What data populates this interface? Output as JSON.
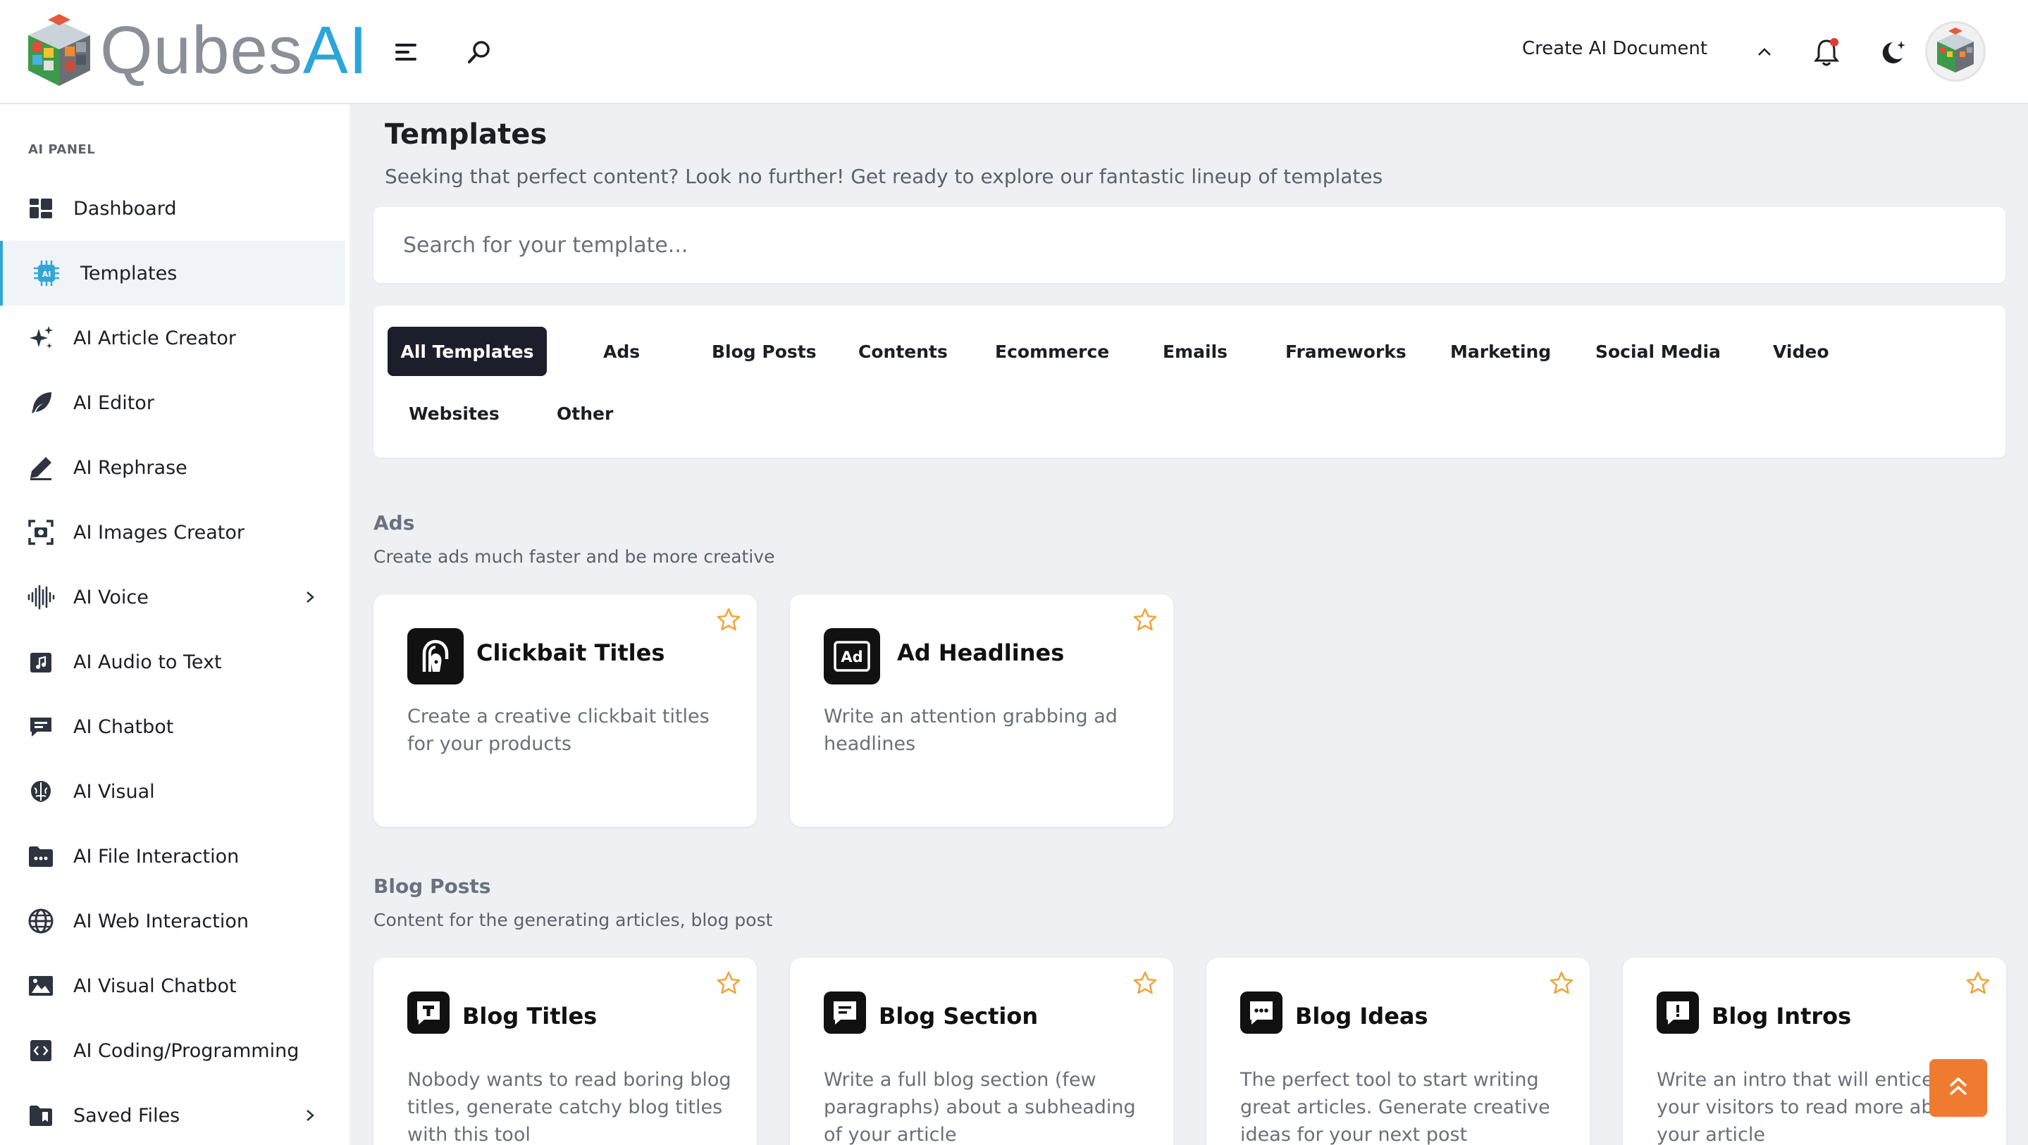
{
  "header": {
    "logo_main": "Qubes",
    "logo_accent": "AI",
    "create_doc_label": "Create AI Document",
    "notification_dot_color": "#e53935"
  },
  "sidebar": {
    "panel_title": "AI PANEL",
    "items": [
      {
        "label": "Dashboard",
        "icon": "dashboard-icon"
      },
      {
        "label": "Templates",
        "icon": "ai-chip-icon",
        "active": true
      },
      {
        "label": "AI Article Creator",
        "icon": "sparkles-icon"
      },
      {
        "label": "AI Editor",
        "icon": "feather-icon"
      },
      {
        "label": "AI Rephrase",
        "icon": "pen-icon"
      },
      {
        "label": "AI Images Creator",
        "icon": "image-scan-icon"
      },
      {
        "label": "AI Voice",
        "icon": "soundwave-icon",
        "has_children": true
      },
      {
        "label": "AI Audio to Text",
        "icon": "music-file-icon"
      },
      {
        "label": "AI Chatbot",
        "icon": "chat-icon"
      },
      {
        "label": "AI Visual",
        "icon": "brain-icon"
      },
      {
        "label": "AI File Interaction",
        "icon": "folder-dots-icon"
      },
      {
        "label": "AI Web Interaction",
        "icon": "globe-icon"
      },
      {
        "label": "AI Visual Chatbot",
        "icon": "photo-icon"
      },
      {
        "label": "AI Coding/Programming",
        "icon": "code-icon"
      },
      {
        "label": "Saved Files",
        "icon": "saved-folder-icon",
        "has_children": true
      }
    ]
  },
  "main": {
    "title": "Templates",
    "subtitle": "Seeking that perfect content? Look no further! Get ready to explore our fantastic lineup of templates",
    "search_placeholder": "Search for your template...",
    "filters": [
      "All Templates",
      "Ads",
      "Blog Posts",
      "Contents",
      "Ecommerce",
      "Emails",
      "Frameworks",
      "Marketing",
      "Social Media",
      "Video",
      "Websites",
      "Other"
    ],
    "active_filter": "All Templates",
    "sections": [
      {
        "title": "Ads",
        "subtitle": "Create ads much faster and be more creative",
        "cards": [
          {
            "title": "Clickbait Titles",
            "desc": "Create a creative clickbait titles for your products",
            "icon": "clickbait-icon"
          },
          {
            "title": "Ad Headlines",
            "desc": "Write an attention grabbing ad headlines",
            "icon": "ad-icon"
          }
        ]
      },
      {
        "title": "Blog Posts",
        "subtitle": "Content for the generating articles, blog post",
        "cards": [
          {
            "title": "Blog Titles",
            "desc": "Nobody wants to read boring blog titles, generate catchy blog titles with this tool",
            "icon": "title-chat-icon"
          },
          {
            "title": "Blog Section",
            "desc": "Write a full blog section (few paragraphs) about a subheading of your article",
            "icon": "section-chat-icon"
          },
          {
            "title": "Blog Ideas",
            "desc": "The perfect tool to start writing great articles. Generate creative ideas for your next post",
            "icon": "ideas-chat-icon"
          },
          {
            "title": "Blog Intros",
            "desc": "Write an intro that will entice your visitors to read more about your article",
            "icon": "intro-chat-icon"
          }
        ]
      }
    ]
  },
  "colors": {
    "accent": "#33a6d6",
    "star": "#f0a63a",
    "scroll_top": "#ee7b2f",
    "active_filter_bg": "#1c1e2b"
  }
}
